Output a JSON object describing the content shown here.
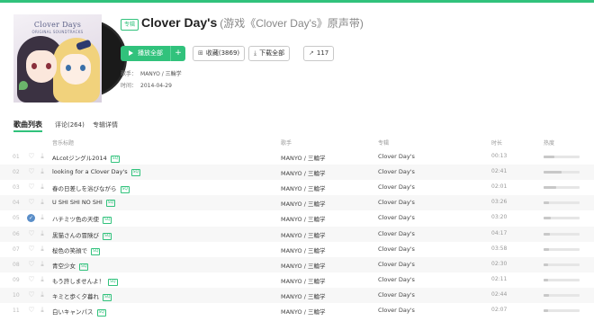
{
  "album": {
    "badge": "专辑",
    "title_main": "Clover Day's",
    "title_sub": "(游戏《Clover Day's》原声带)",
    "cover_title": "Clover Days",
    "cover_subtitle": "ORIGINAL SOUNDTRACKS"
  },
  "actions": {
    "play_all": "播放全部",
    "add": "+",
    "favorite": "收藏(3869)",
    "download_all": "下载全部",
    "share_count": "117"
  },
  "meta": {
    "singer_label": "歌手：",
    "singer_value": "MANYO / 三輪学",
    "date_label": "时间：",
    "date_value": "2014-04-29"
  },
  "tabs": [
    {
      "label": "歌曲列表",
      "active": true
    },
    {
      "label": "评论(264)",
      "active": false
    },
    {
      "label": "专辑详情",
      "active": false
    }
  ],
  "table": {
    "headers": {
      "title": "音乐标题",
      "artist": "歌手",
      "album": "专辑",
      "duration": "时长",
      "heat": "热度"
    },
    "rows": [
      {
        "num": "01",
        "title": "ALcotジングル2014",
        "tag": "SQ",
        "artist": "MANYO / 三輪学",
        "album": "Clover Day's",
        "duration": "00:13",
        "heat": 0.3,
        "fav": false
      },
      {
        "num": "02",
        "title": "looking for a Clover Day's",
        "tag": "SQ",
        "artist": "MANYO / 三輪学",
        "album": "Clover Day's",
        "duration": "02:41",
        "heat": 0.5,
        "fav": false
      },
      {
        "num": "03",
        "title": "春の日差しを浴びながら",
        "tag": "SQ",
        "artist": "MANYO / 三輪学",
        "album": "Clover Day's",
        "duration": "02:01",
        "heat": 0.35,
        "fav": false
      },
      {
        "num": "04",
        "title": "U SHI SHI NO SHI",
        "tag": "SQ",
        "artist": "MANYO / 三輪学",
        "album": "Clover Day's",
        "duration": "03:26",
        "heat": 0.15,
        "fav": false
      },
      {
        "num": "05",
        "title": "ハチミツ色の天使",
        "tag": "SQ",
        "artist": "MANYO / 三輪学",
        "album": "Clover Day's",
        "duration": "03:20",
        "heat": 0.2,
        "fav": true
      },
      {
        "num": "06",
        "title": "黒猫さんの冒険び",
        "tag": "SQ",
        "artist": "MANYO / 三輪学",
        "album": "Clover Day's",
        "duration": "04:17",
        "heat": 0.18,
        "fav": false
      },
      {
        "num": "07",
        "title": "桜色の笑顔で",
        "tag": "SQ",
        "artist": "MANYO / 三輪学",
        "album": "Clover Day's",
        "duration": "03:58",
        "heat": 0.15,
        "fav": false
      },
      {
        "num": "08",
        "title": "青空少女",
        "tag": "SQ",
        "artist": "MANYO / 三輪学",
        "album": "Clover Day's",
        "duration": "02:30",
        "heat": 0.12,
        "fav": false
      },
      {
        "num": "09",
        "title": "もう許しませんよ！",
        "tag": "SQ",
        "artist": "MANYO / 三輪学",
        "album": "Clover Day's",
        "duration": "02:11",
        "heat": 0.12,
        "fav": false
      },
      {
        "num": "10",
        "title": "キミと歩く夕暮れ",
        "tag": "SQ",
        "artist": "MANYO / 三輪学",
        "album": "Clover Day's",
        "duration": "02:44",
        "heat": 0.14,
        "fav": false
      },
      {
        "num": "11",
        "title": "白いキャンパス",
        "tag": "SQ",
        "artist": "MANYO / 三輪学",
        "album": "Clover Day's",
        "duration": "02:07",
        "heat": 0.12,
        "fav": false
      }
    ]
  },
  "colors": {
    "accent": "#31c27c",
    "row_alt": "#f7f7f7",
    "heat_fill": "#c8c8c8"
  },
  "icons": {
    "play": "play-icon",
    "favorite": "folder-heart-icon",
    "download": "download-icon",
    "share": "share-icon",
    "like": "heart-icon",
    "liked": "check-circle-icon"
  }
}
